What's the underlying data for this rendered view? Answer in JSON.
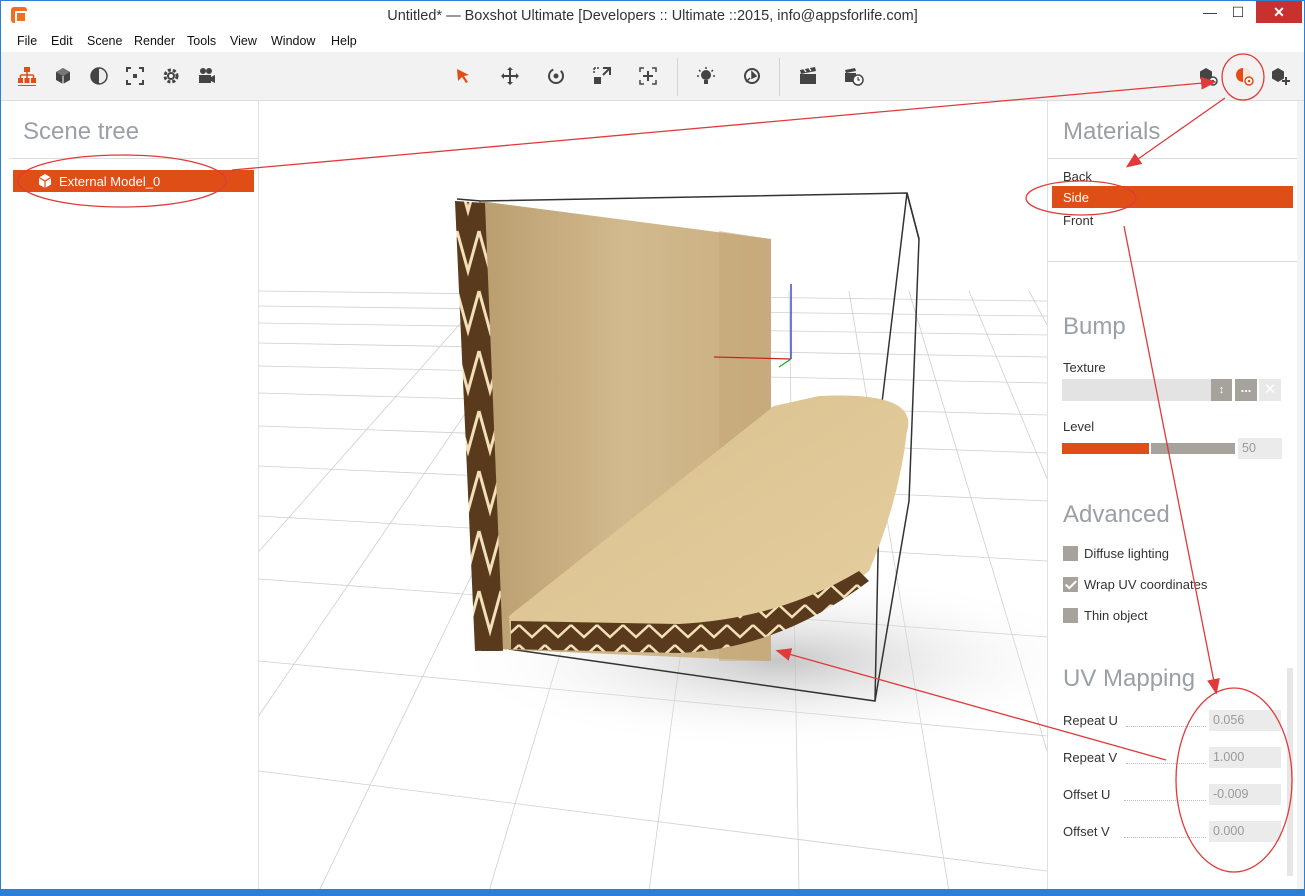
{
  "window": {
    "title": "Untitled* — Boxshot Ultimate [Developers :: Ultimate ::2015, info@appsforlife.com]",
    "minimize": "—",
    "maximize": "☐",
    "close": "✕"
  },
  "menu": [
    "File",
    "Edit",
    "Scene",
    "Render",
    "Tools",
    "View",
    "Window",
    "Help"
  ],
  "toolbar": {
    "left_icons": [
      "scene-tree-icon",
      "object-cube-icon",
      "material-ball-icon",
      "frame-select-icon",
      "settings-gear-icon",
      "camera-icon"
    ],
    "center_icons": [
      "select-arrow-icon",
      "move-icon",
      "rotate-icon",
      "scale-icon",
      "fit-icon",
      "light-icon",
      "environment-icon"
    ],
    "right_icons": [
      "clapper-icon",
      "render-timer-icon",
      "object-settings-icon",
      "material-settings-icon",
      "add-object-icon"
    ],
    "accent": "#e04e17"
  },
  "scene_tree": {
    "title": "Scene tree",
    "items": [
      {
        "label": "External Model_0",
        "icon": "cube-icon"
      }
    ]
  },
  "materials": {
    "title": "Materials",
    "items": [
      "Back",
      "Side",
      "Front"
    ],
    "selected": "Side"
  },
  "bump": {
    "title": "Bump",
    "texture_label": "Texture",
    "texture_value": "",
    "browse": "...",
    "clear": "✕",
    "spin": "↕",
    "level_label": "Level",
    "level_value": "50",
    "level_fraction": 0.5
  },
  "advanced": {
    "title": "Advanced",
    "options": [
      {
        "label": "Diffuse lighting",
        "checked": false
      },
      {
        "label": "Wrap UV coordinates",
        "checked": true
      },
      {
        "label": "Thin object",
        "checked": false
      }
    ]
  },
  "uv_mapping": {
    "title": "UV Mapping",
    "fields": [
      {
        "label": "Repeat U",
        "value": "0.056"
      },
      {
        "label": "Repeat V",
        "value": "1.000"
      },
      {
        "label": "Offset U",
        "value": "-0.009"
      },
      {
        "label": "Offset V",
        "value": "0.000"
      }
    ]
  },
  "colors": {
    "accent": "#e04e17",
    "annotation": "#e03a3a",
    "frame": "#2d7fd3"
  }
}
